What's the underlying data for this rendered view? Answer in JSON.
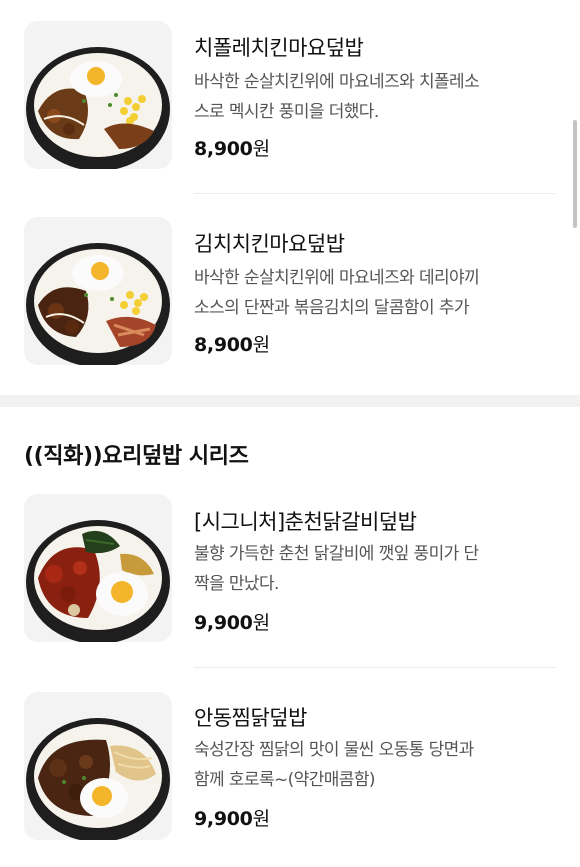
{
  "items_top": [
    {
      "name": "치폴레치킨마요덮밥",
      "desc_line1": "바삭한 순살치킨위에 마요네즈와 치폴레소",
      "desc_line2": "스로 멕시칸 풍미을 더했다.",
      "price": "8,900",
      "currency": "원",
      "image": "chipotle-chicken-mayo-rice-bowl"
    },
    {
      "name": "김치치킨마요덮밥",
      "desc_line1": "바삭한 순살치킨위에 마요네즈와 데리야끼",
      "desc_line2": "소스의 단짠과 볶음김치의 달콤함이 추가",
      "price": "8,900",
      "currency": "원",
      "image": "kimchi-chicken-mayo-rice-bowl"
    }
  ],
  "section_title": "((직화))요리덮밥 시리즈",
  "items_bottom": [
    {
      "name": "[시그니처]춘천닭갈비덮밥",
      "desc_line1": "불향 가득한 춘천 닭갈비에 깻잎 풍미가 단",
      "desc_line2": "짝을 만났다.",
      "price": "9,900",
      "currency": "원",
      "image": "chuncheon-dakgalbi-rice-bowl"
    },
    {
      "name": "안동찜닭덮밥",
      "desc_line1": "숙성간장 찜닭의 맛이 물씬 오동통 당면과",
      "desc_line2": "함께 호로록~(약간매콤함)",
      "price": "9,900",
      "currency": "원",
      "image": "andong-jjimdak-rice-bowl"
    }
  ],
  "colors": {
    "background": "#ffffff",
    "section_separator": "#f2f2f2",
    "text_primary": "#111111",
    "text_secondary": "#555555"
  }
}
